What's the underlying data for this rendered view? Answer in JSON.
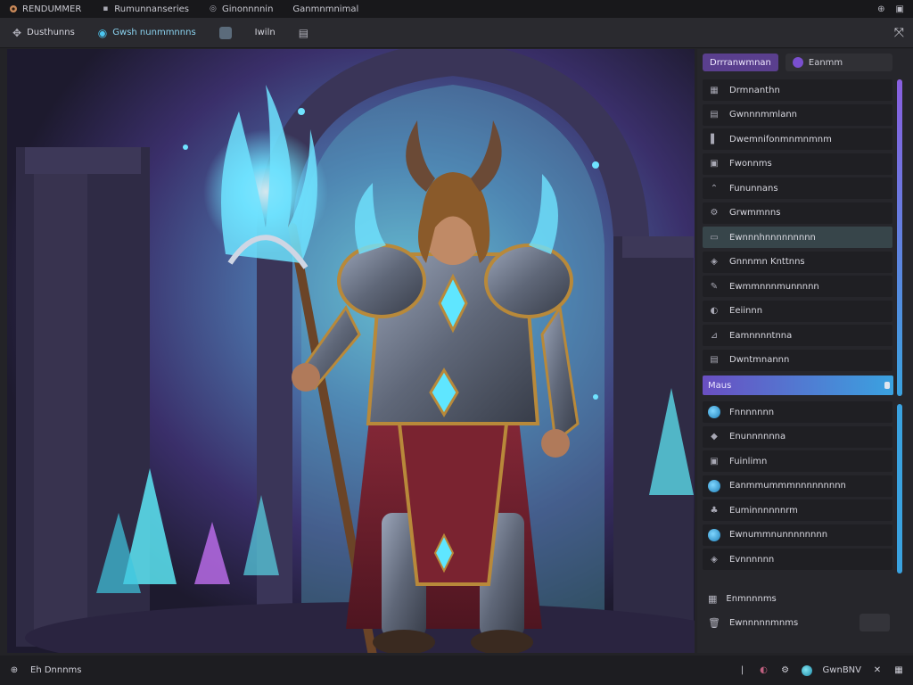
{
  "menubar": {
    "items": [
      {
        "icon": "app-logo-icon",
        "label": "RENDUMMER"
      },
      {
        "icon": "dot-icon",
        "label": "Rumunnanseries"
      },
      {
        "icon": "camera-icon",
        "label": "Ginonnnnin"
      },
      {
        "icon": "",
        "label": "Ganmnmnimal"
      }
    ],
    "right_icons": [
      "globe-icon",
      "window-icon"
    ]
  },
  "toolbar": {
    "items": [
      {
        "icon": "move-icon",
        "label": "Dusthunns",
        "active": false
      },
      {
        "icon": "eye-icon",
        "label": "Gwsh nunmmnnns",
        "active": true
      },
      {
        "icon": "layer-icon",
        "label": "",
        "active": false
      },
      {
        "icon": "",
        "label": "Iwiln",
        "active": false
      },
      {
        "icon": "image-icon",
        "label": "",
        "active": false
      }
    ],
    "right_icon": "pan-icon"
  },
  "panel": {
    "tabs": [
      {
        "label": "Drrranwmnan",
        "active": true
      },
      {
        "label": "Eanmm",
        "active": false
      }
    ],
    "list_top": [
      {
        "icon": "grid-icon",
        "label": "Drmnanthn"
      },
      {
        "icon": "layers-icon",
        "label": "Gwnnnmmlann"
      },
      {
        "icon": "bar-icon",
        "label": "Dwemnifonmnmnmnm"
      },
      {
        "icon": "frame-icon",
        "label": "Fwonnms"
      },
      {
        "icon": "mountain-icon",
        "label": "Fununnans"
      },
      {
        "icon": "gear-icon",
        "label": "Grwmmnns"
      },
      {
        "icon": "minus-icon",
        "label": "Ewnnnhnnnnnnnnn",
        "selected": true
      },
      {
        "icon": "drop-icon",
        "label": "Gnnnmn Knttnns"
      },
      {
        "icon": "brush-icon",
        "label": "Ewmmnnnmunnnnn"
      },
      {
        "icon": "palette-icon",
        "label": "Eeiinnn"
      },
      {
        "icon": "adjust-icon",
        "label": "Eamnnnntnna"
      },
      {
        "icon": "list-icon",
        "label": "Dwntmnannn"
      }
    ],
    "slider": {
      "label": "Maus",
      "value": 1.0
    },
    "list_bottom": [
      {
        "icon": "globe-icon",
        "label": "Fnnnnnnn"
      },
      {
        "icon": "crystal-icon",
        "label": "Enunnnnnna"
      },
      {
        "icon": "frame-icon",
        "label": "Fuinlimn"
      },
      {
        "icon": "globe-icon",
        "label": "Eanmmummmnnnnnnnnn"
      },
      {
        "icon": "leaf-icon",
        "label": "Euminnnnnnrm"
      },
      {
        "icon": "globe-icon",
        "label": "Ewnummnunnnnnnnn"
      },
      {
        "icon": "drop-icon",
        "label": "Evnnnnnn"
      }
    ],
    "footer_rows": [
      {
        "icon": "grid-icon",
        "label": "Enmnnnms"
      },
      {
        "icon": "trash-icon",
        "label": "Ewnnnnnmnms"
      }
    ]
  },
  "statusbar": {
    "left_label": "Eh Dnnnms",
    "right_label": "GwnBNV",
    "right_icons": [
      "cursor-icon",
      "color-icon",
      "settings-icon",
      "globe-icon",
      "close-icon",
      "grid-icon"
    ]
  },
  "colors": {
    "accent": "#5a3f8e",
    "scroll_purple": "#8a5fe0",
    "scroll_blue": "#3aa2e0"
  }
}
